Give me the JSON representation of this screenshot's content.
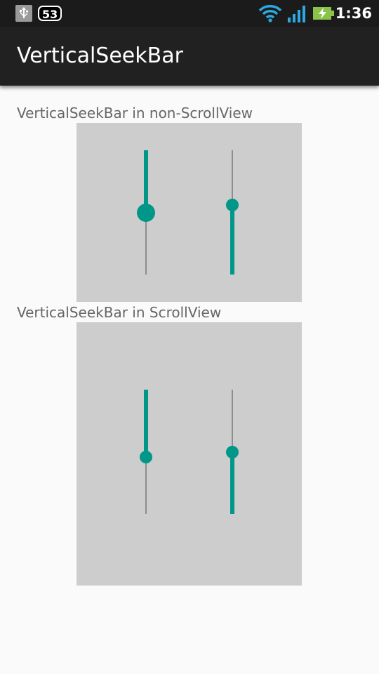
{
  "status_bar": {
    "notification_count": "53",
    "time": "1:36",
    "icons": [
      "usb-icon",
      "wifi-icon",
      "signal-icon",
      "battery-charging-icon"
    ]
  },
  "action_bar": {
    "title": "VerticalSeekBar"
  },
  "sections": [
    {
      "label": "VerticalSeekBar in non-ScrollView",
      "seekbars": [
        {
          "name": "top-to-bottom",
          "direction": "top-to-bottom",
          "progress": 0.5,
          "pressed": true
        },
        {
          "name": "bottom-to-top",
          "direction": "bottom-to-top",
          "progress": 0.56,
          "pressed": false
        }
      ]
    },
    {
      "label": "VerticalSeekBar in ScrollView",
      "seekbars": [
        {
          "name": "top-to-bottom",
          "direction": "top-to-bottom",
          "progress": 0.54,
          "pressed": false
        },
        {
          "name": "bottom-to-top",
          "direction": "bottom-to-top",
          "progress": 0.5,
          "pressed": false
        }
      ]
    }
  ],
  "colors": {
    "accent": "#009688",
    "track": "#8d8d8d",
    "panel_background": "#cdcdcd",
    "label_text": "#666666",
    "action_bar": "#212121",
    "status_bar": "#1b1b1b"
  }
}
